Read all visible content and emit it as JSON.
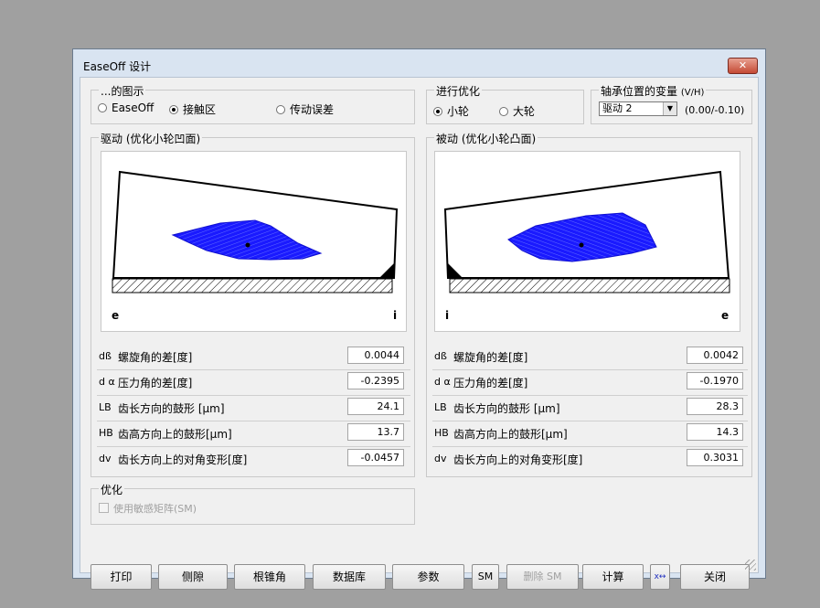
{
  "window": {
    "title": "EaseOff 设计",
    "close_label": "✕"
  },
  "display_group": {
    "title": "...的图示",
    "options": [
      "EaseOff",
      "接触区",
      "传动误差"
    ],
    "selected": "接触区"
  },
  "optimize_group": {
    "title": "进行优化",
    "options": [
      "小轮",
      "大轮"
    ],
    "selected": "小轮"
  },
  "bearing_group": {
    "title": "轴承位置的变量",
    "title_suffix": "(V/H)",
    "select_value": "驱动 2",
    "range_text": "(0.00/-0.10)"
  },
  "drive_panel": {
    "title": "驱动 (优化小轮凹面)",
    "left_label": "e",
    "right_label": "i",
    "rows": [
      {
        "sym": "dß",
        "label": "螺旋角的差[度]",
        "value": "0.0044"
      },
      {
        "sym": "d α",
        "label": "压力角的差[度]",
        "value": "-0.2395"
      },
      {
        "sym": "LB",
        "label": "齿长方向的鼓形 [µm]",
        "value": "24.1"
      },
      {
        "sym": "HB",
        "label": "齿高方向上的鼓形[µm]",
        "value": "13.7"
      },
      {
        "sym": "dv",
        "label": "齿长方向上的对角变形[度]",
        "value": "-0.0457"
      }
    ]
  },
  "coast_panel": {
    "title": "被动 (优化小轮凸面)",
    "left_label": "i",
    "right_label": "e",
    "rows": [
      {
        "sym": "dß",
        "label": "螺旋角的差[度]",
        "value": "0.0042"
      },
      {
        "sym": "d α",
        "label": "压力角的差[度]",
        "value": "-0.1970"
      },
      {
        "sym": "LB",
        "label": "齿长方向的鼓形 [µm]",
        "value": "28.3"
      },
      {
        "sym": "HB",
        "label": "齿高方向上的鼓形[µm]",
        "value": "14.3"
      },
      {
        "sym": "dv",
        "label": "齿长方向上的对角变形[度]",
        "value": "0.3031"
      }
    ]
  },
  "opt_group": {
    "title": "优化",
    "checkbox_label": "使用敏感矩阵(SM)"
  },
  "buttons": {
    "print": "打印",
    "backlash": "侧隙",
    "root_cone": "根锥角",
    "database": "数据库",
    "params": "参数",
    "sm": "SM",
    "delete_sm": "删除 SM",
    "calculate": "计算",
    "xy_icon": "x↔",
    "close": "关闭"
  },
  "colors": {
    "contact": "#1a1aff",
    "window_frame": "#d9e4f1"
  }
}
